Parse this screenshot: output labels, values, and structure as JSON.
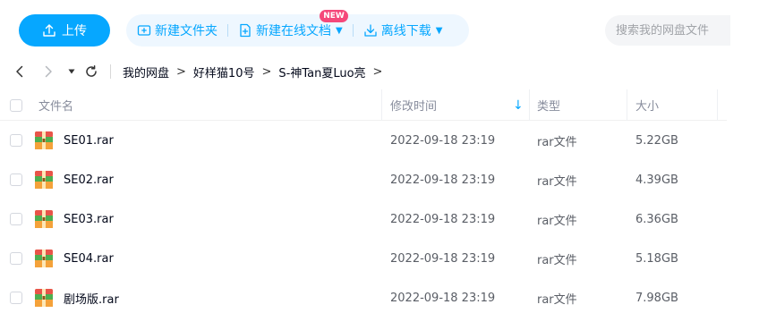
{
  "toolbar": {
    "upload_label": "上传",
    "new_folder_label": "新建文件夹",
    "new_online_doc_label": "新建在线文档",
    "new_badge": "NEW",
    "offline_download_label": "离线下载",
    "search_placeholder": "搜索我的网盘文件"
  },
  "breadcrumb": [
    "我的网盘",
    "好样猫10号",
    "S-神Tan夏Luo亮"
  ],
  "table": {
    "headers": {
      "name": "文件名",
      "mtime": "修改时间",
      "type": "类型",
      "size": "大小"
    },
    "rows": [
      {
        "name": "SE01.rar",
        "mtime": "2022-09-18 23:19",
        "type": "rar文件",
        "size": "5.22GB"
      },
      {
        "name": "SE02.rar",
        "mtime": "2022-09-18 23:19",
        "type": "rar文件",
        "size": "4.39GB"
      },
      {
        "name": "SE03.rar",
        "mtime": "2022-09-18 23:19",
        "type": "rar文件",
        "size": "6.36GB"
      },
      {
        "name": "SE04.rar",
        "mtime": "2022-09-18 23:19",
        "type": "rar文件",
        "size": "5.18GB"
      },
      {
        "name": "剧场版.rar",
        "mtime": "2022-09-18 23:19",
        "type": "rar文件",
        "size": "7.98GB"
      }
    ]
  },
  "colors": {
    "accent": "#06a7ff",
    "badge": "#f5487a",
    "action_bg": "#eef7ff"
  },
  "icons": {
    "file": "rar-archive-icon",
    "sort": "arrow-down-icon"
  }
}
